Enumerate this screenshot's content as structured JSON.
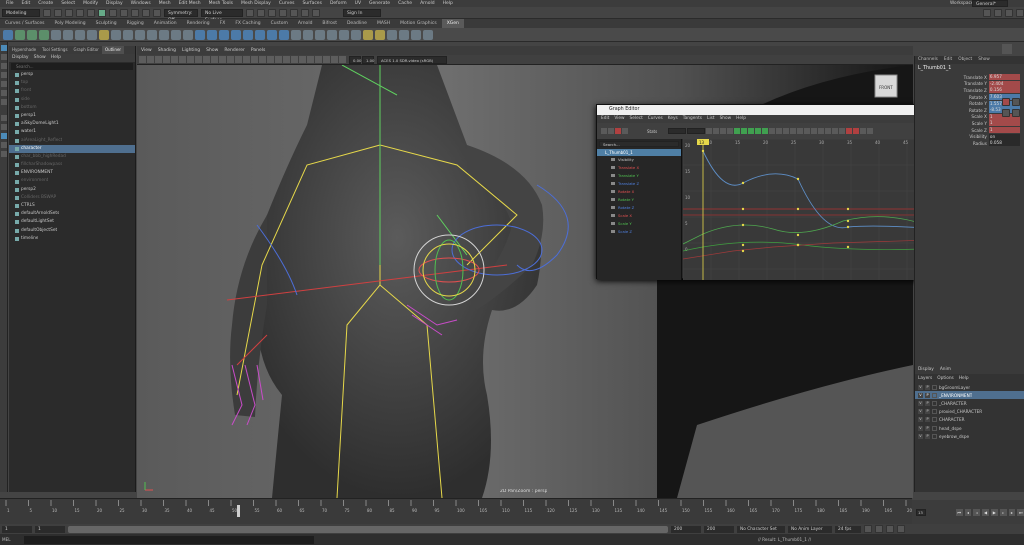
{
  "menubar": {
    "items": [
      "File",
      "Edit",
      "Create",
      "Select",
      "Modify",
      "Display",
      "Windows",
      "Mesh",
      "Edit Mesh",
      "Mesh Tools",
      "Mesh Display",
      "Curves",
      "Surfaces",
      "Deform",
      "UV",
      "Generate",
      "Cache",
      "Arnold",
      "Help"
    ],
    "workspace_label": "Workspace:",
    "workspace_value": "General*"
  },
  "statusline": {
    "mode": "Modeling",
    "symmetry": "Symmetry: Off",
    "live_surface": "No Live Surface",
    "sign_in": "Sign In"
  },
  "shelf": {
    "tabs": [
      "Curves / Surfaces",
      "Poly Modeling",
      "Sculpting",
      "Rigging",
      "Animation",
      "Rendering",
      "FX",
      "FX Caching",
      "Custom",
      "Arnold",
      "Bifrost",
      "Deadline",
      "MASH",
      "Motion Graphics",
      "XGen"
    ],
    "active_tab": "XGen"
  },
  "outliner": {
    "tabs": [
      "Hypershade",
      "Tool Settings",
      "Graph Editor",
      "Outliner"
    ],
    "active_tab": "Outliner",
    "menu": [
      "Display",
      "Show",
      "Help"
    ],
    "search_placeholder": "Search...",
    "items": [
      {
        "label": "persp",
        "dim": false,
        "sel": false
      },
      {
        "label": "top",
        "dim": true,
        "sel": false
      },
      {
        "label": "front",
        "dim": true,
        "sel": false
      },
      {
        "label": "side",
        "dim": true,
        "sel": false
      },
      {
        "label": "bottom",
        "dim": true,
        "sel": false
      },
      {
        "label": "persp1",
        "dim": false,
        "sel": false
      },
      {
        "label": "aiSkyDomeLight1",
        "dim": false,
        "sel": false
      },
      {
        "label": "water1",
        "dim": false,
        "sel": false
      },
      {
        "label": "aiAreaLight_Reflect",
        "dim": true,
        "sel": false
      },
      {
        "label": "character",
        "dim": false,
        "sel": true
      },
      {
        "label": "char_bbb_highRedad",
        "dim": true,
        "sel": false
      },
      {
        "label": "fillcharShadowpass",
        "dim": true,
        "sel": false
      },
      {
        "label": "ENVIRONMENT",
        "dim": false,
        "sel": false
      },
      {
        "label": "environment",
        "dim": true,
        "sel": false
      },
      {
        "label": "persp2",
        "dim": false,
        "sel": false
      },
      {
        "label": "Colliders BSWAP",
        "dim": true,
        "sel": false
      },
      {
        "label": "CTRLS",
        "dim": false,
        "sel": false
      },
      {
        "label": "defaultArnoldSets",
        "dim": false,
        "sel": false
      },
      {
        "label": "defaultLightSet",
        "dim": false,
        "sel": false
      },
      {
        "label": "defaultObjectSet",
        "dim": false,
        "sel": false
      },
      {
        "label": "timeline",
        "dim": false,
        "sel": false
      }
    ]
  },
  "viewport": {
    "menu": [
      "View",
      "Shading",
      "Lighting",
      "Show",
      "Renderer",
      "Panels"
    ],
    "colorspace": "ACES 1.0 SDR-video (sRGB)",
    "exposure": "0.00",
    "gamma": "1.00",
    "label": "2D Pan/Zoom : persp",
    "cube_label": "FRONT"
  },
  "graph_editor": {
    "title": "Graph Editor",
    "menu": [
      "Edit",
      "View",
      "Select",
      "Curves",
      "Keys",
      "Tangents",
      "List",
      "Show",
      "Help"
    ],
    "stats_label": "Stats",
    "search_placeholder": "Search...",
    "node": "L_Thumb01_1",
    "channels": [
      {
        "name": "Visibility",
        "color": "#c8c8c8"
      },
      {
        "name": "Translate X",
        "color": "#e05050"
      },
      {
        "name": "Translate Y",
        "color": "#50c050"
      },
      {
        "name": "Translate Z",
        "color": "#5080e0"
      },
      {
        "name": "Rotate X",
        "color": "#e05050"
      },
      {
        "name": "Rotate Y",
        "color": "#50c050"
      },
      {
        "name": "Rotate Z",
        "color": "#5080e0"
      },
      {
        "name": "Scale X",
        "color": "#e05050"
      },
      {
        "name": "Scale Y",
        "color": "#50c050"
      },
      {
        "name": "Scale Z",
        "color": "#5080e0"
      }
    ],
    "y_labels": [
      "20",
      "15",
      "10",
      "5",
      "0"
    ],
    "x_labels": [
      "10",
      "15",
      "20",
      "25",
      "30",
      "35",
      "40",
      "45",
      "50",
      "55",
      "60"
    ],
    "current_frame": "13"
  },
  "channel_box": {
    "tabs": [
      "Channels",
      "Edit",
      "Object",
      "Show"
    ],
    "object_name": "L_Thumb01_1",
    "rows": [
      {
        "name": "Translate X",
        "value": "6.957",
        "style": "red"
      },
      {
        "name": "Translate Y",
        "value": "-2.404",
        "style": "red"
      },
      {
        "name": "Translate Z",
        "value": "0.156",
        "style": "red"
      },
      {
        "name": "Rotate X",
        "value": "7.603",
        "style": "blue"
      },
      {
        "name": "Rotate Y",
        "value": "1.557",
        "style": "blue"
      },
      {
        "name": "Rotate Z",
        "value": "-8.53",
        "style": "blue"
      },
      {
        "name": "Scale X",
        "value": "1",
        "style": "red"
      },
      {
        "name": "Scale Y",
        "value": "1",
        "style": "red"
      },
      {
        "name": "Scale Z",
        "value": "1",
        "style": "red"
      },
      {
        "name": "Visibility",
        "value": "on",
        "style": "plain"
      },
      {
        "name": "Radius",
        "value": "0.058",
        "style": "plain"
      }
    ]
  },
  "layers": {
    "tabs": [
      "Display",
      "Anim"
    ],
    "menu": [
      "Layers",
      "Options",
      "Help"
    ],
    "rows": [
      {
        "label": "bgGroomLayer",
        "sel": false
      },
      {
        "label": "_ENVIRONMENT",
        "sel": true
      },
      {
        "label": "_CHARACTER",
        "sel": false
      },
      {
        "label": "proxied_CHARACTER",
        "sel": false
      },
      {
        "label": "CHARACTER",
        "sel": false
      },
      {
        "label": "head_dspe",
        "sel": false
      },
      {
        "label": "eyebrow_dspe",
        "sel": false
      }
    ]
  },
  "timeline": {
    "ticks": [
      "1",
      "5",
      "10",
      "15",
      "20",
      "25",
      "30",
      "35",
      "40",
      "45",
      "50",
      "55",
      "60",
      "65",
      "70",
      "75",
      "80",
      "85",
      "90",
      "95",
      "100",
      "105",
      "110",
      "115",
      "120",
      "125",
      "130",
      "135",
      "140",
      "145",
      "150",
      "155",
      "160",
      "165",
      "170",
      "175",
      "180",
      "185",
      "190",
      "195",
      "200"
    ],
    "current_frame": "13",
    "start": "1",
    "range_start": "1",
    "range_end": "200",
    "end": "200",
    "character_set": "No Character Set",
    "anim_layer": "No Anim Layer",
    "fps": "24 fps",
    "current_field": "50"
  },
  "cmdline": {
    "lang": "MEL",
    "result": "// Result: L_Thumb01_1 //"
  }
}
